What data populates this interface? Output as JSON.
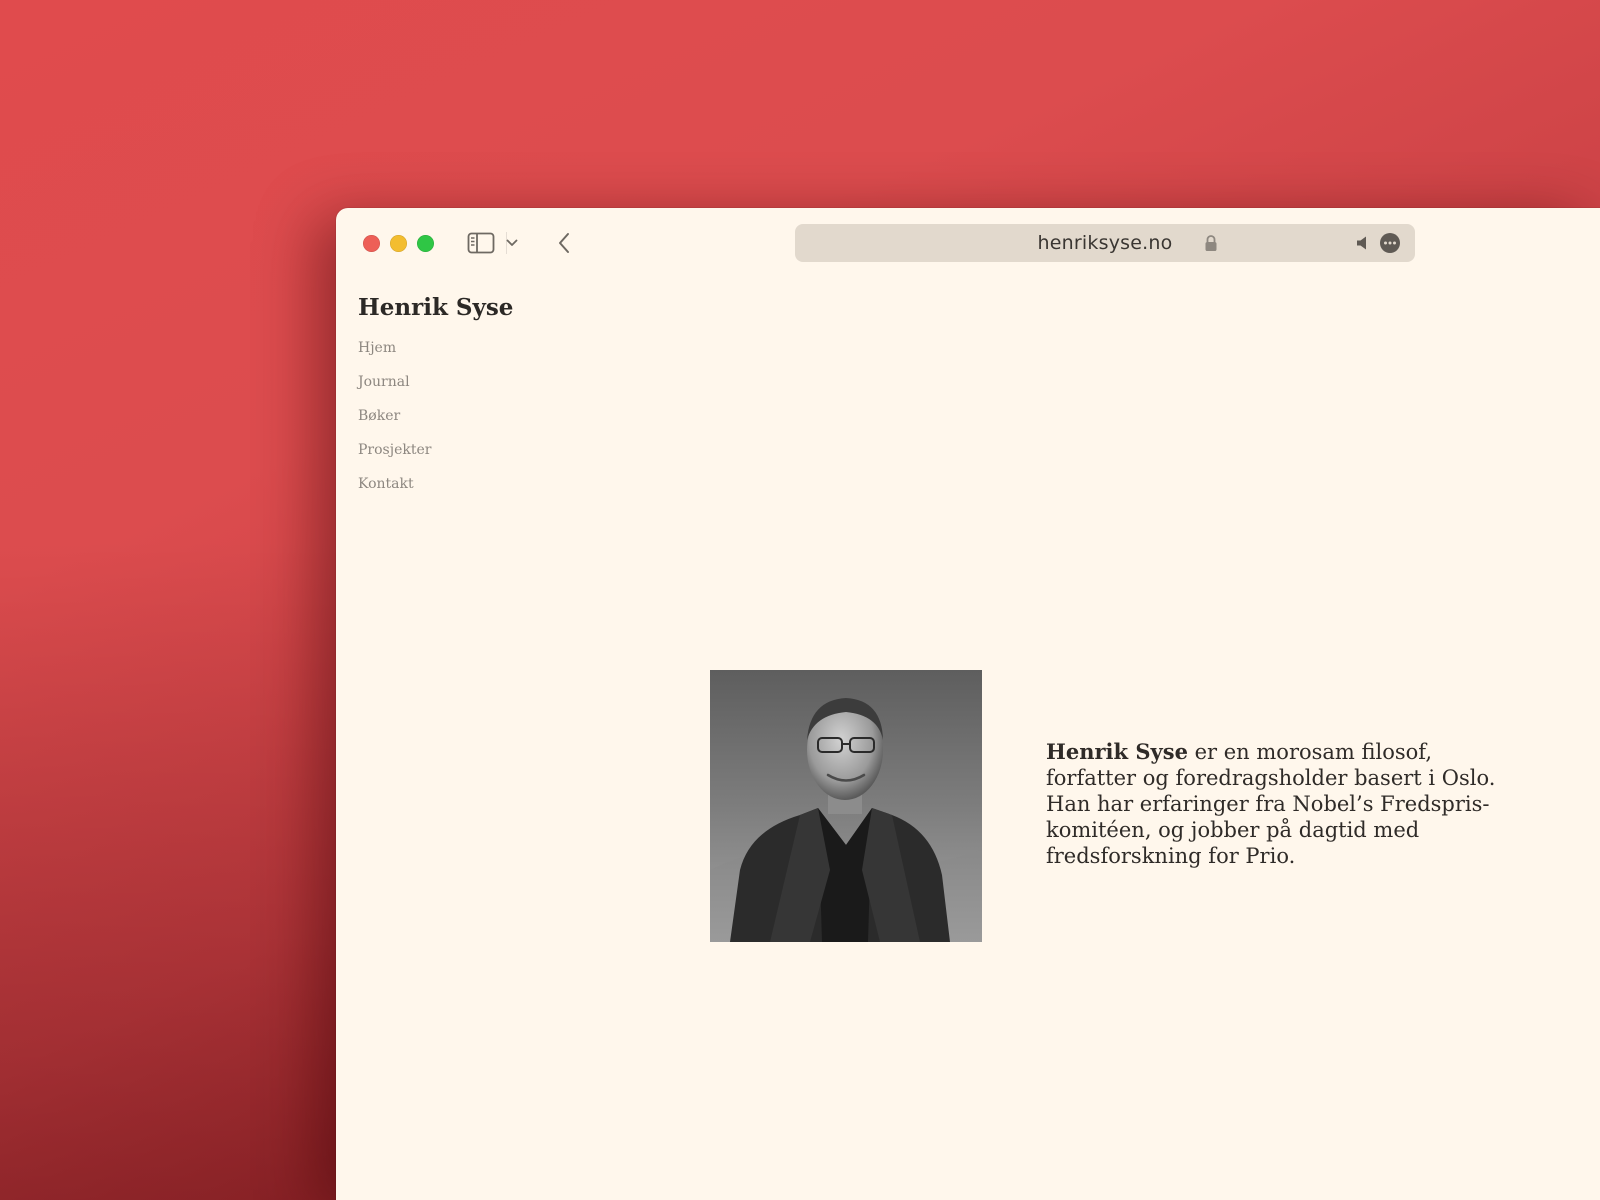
{
  "browser": {
    "url": "henriksyse.no",
    "icons": {
      "sidebar_toggle": "sidebar-icon",
      "tab_overview": "chevron-down-icon",
      "back": "chevron-left-icon",
      "lock": "lock-icon",
      "audio": "speaker-icon",
      "more": "ellipsis-circle-icon"
    },
    "colors": {
      "close": "#ed5f57",
      "minimize": "#f3bd2f",
      "zoom": "#2fc645"
    }
  },
  "site": {
    "title": "Henrik Syse",
    "nav": [
      {
        "label": "Hjem"
      },
      {
        "label": "Journal"
      },
      {
        "label": "Bøker"
      },
      {
        "label": "Prosjekter"
      },
      {
        "label": "Kontakt"
      }
    ]
  },
  "bio": {
    "name": "Henrik Syse",
    "text": " er en morosam filosof, forfatter og foredragsholder basert i Oslo. Han har erfaringer fra Nobel’s Fredspris-komitéen, og jobber på dagtid med fredsforskning for Prio."
  },
  "colors": {
    "page_background": "#fff7ec",
    "desktop_background": "#dc4c4e"
  }
}
